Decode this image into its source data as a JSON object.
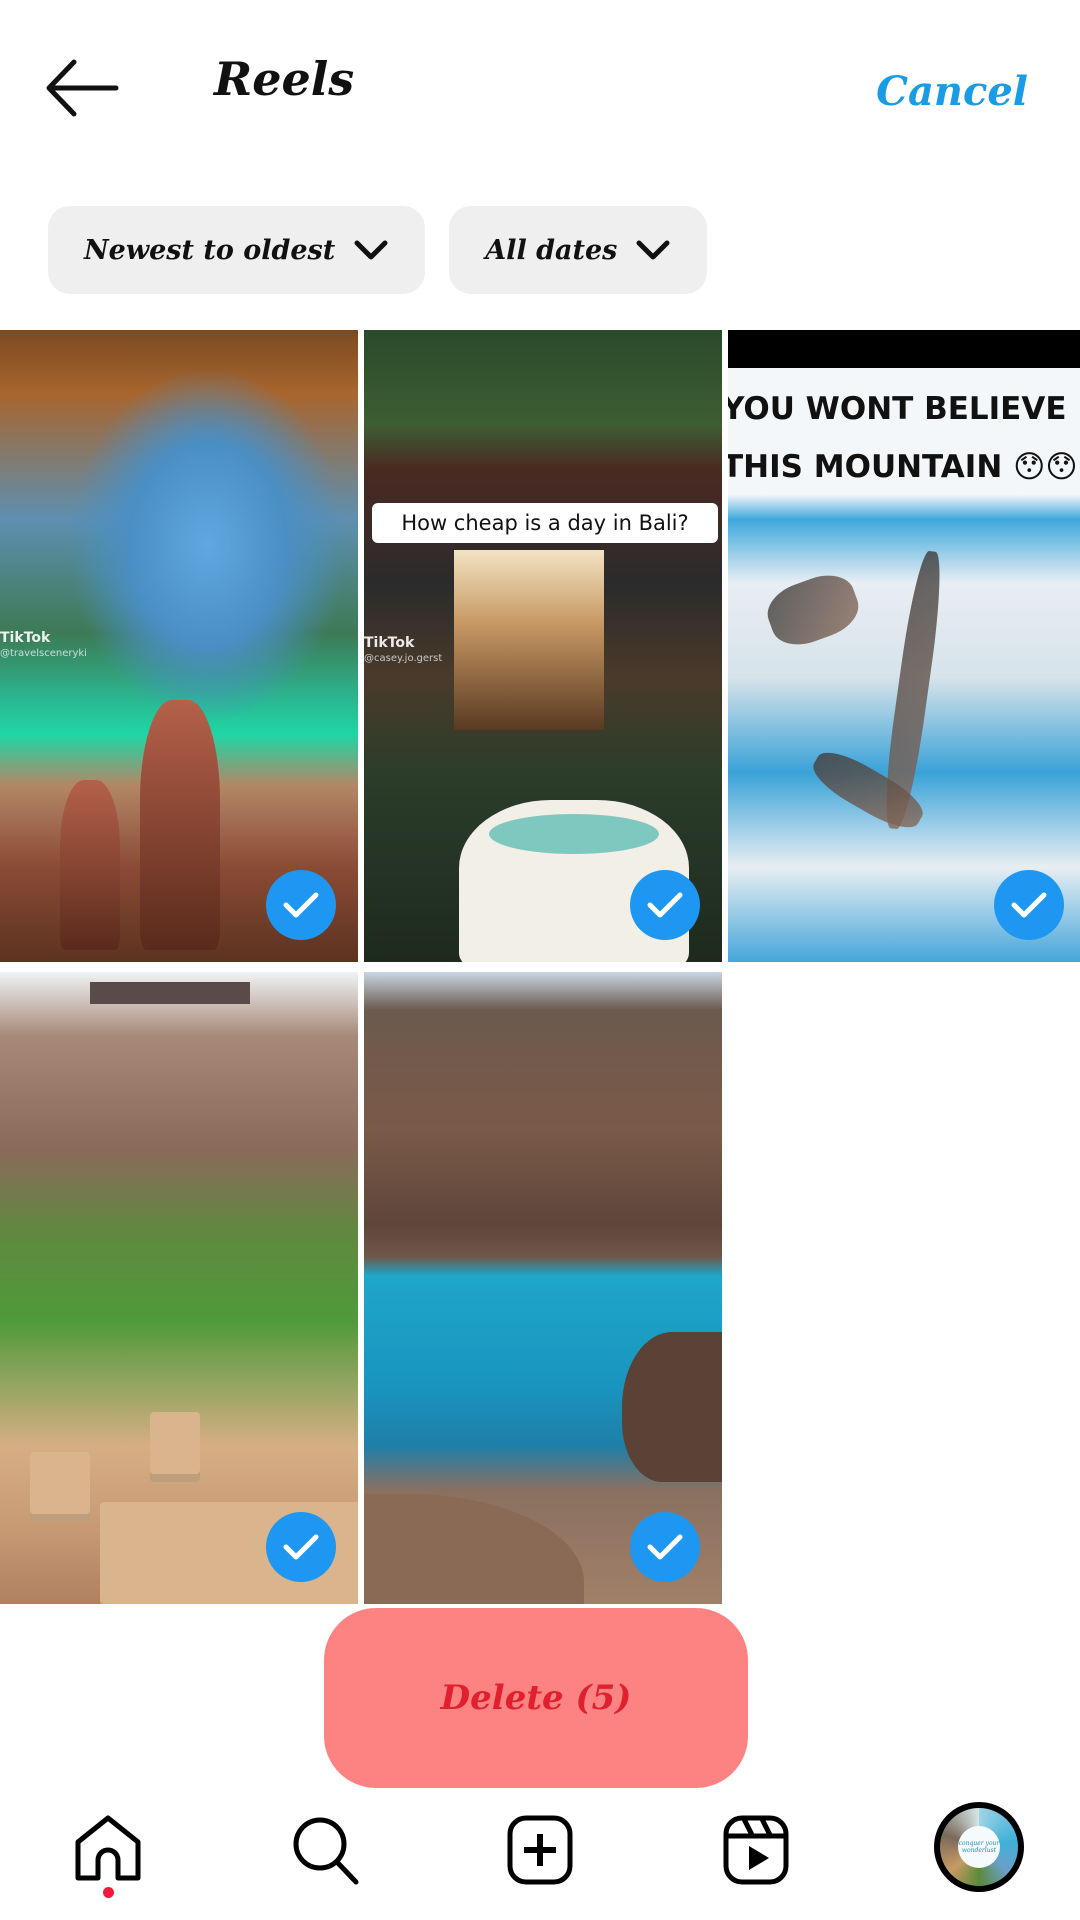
{
  "header": {
    "back_icon": "arrow-left-icon",
    "title": "Reels",
    "cancel_label": "Cancel"
  },
  "filters": [
    {
      "label": "Newest to oldest",
      "icon": "chevron-down-icon"
    },
    {
      "label": "All dates",
      "icon": "chevron-down-icon"
    }
  ],
  "reels": [
    {
      "description": "Cave overlooking turquoise lagoon",
      "watermark": "TikTok",
      "handle": "@travelsceneryki",
      "selected": true
    },
    {
      "description": "Bali villa with pool",
      "caption": "How cheap is a day in Bali?",
      "watermark": "TikTok",
      "handle": "@casey.jo.gerst",
      "selected": true
    },
    {
      "description": "Snowy mountain ridge aerial",
      "caption_line1": "YOU WONT BELIEVE",
      "caption_line2": "THIS MOUNTAIN 😯😯",
      "selected": true
    },
    {
      "description": "Roller coaster through mountain gorge",
      "selected": true
    },
    {
      "description": "Turquoise mountain lake",
      "selected": true
    }
  ],
  "selection": {
    "delete_label": "Delete (5)",
    "count": 5
  },
  "colors": {
    "accent": "#1a9be6",
    "check": "#1e97f2",
    "delete_bg": "#fd8282",
    "delete_text": "#e0202f",
    "notification_dot": "#ef1b3c"
  },
  "nav": {
    "items": [
      {
        "name": "home",
        "icon": "home-icon",
        "active": true
      },
      {
        "name": "search",
        "icon": "search-icon"
      },
      {
        "name": "create",
        "icon": "plus-square-icon"
      },
      {
        "name": "reels",
        "icon": "reels-icon"
      },
      {
        "name": "profile",
        "icon": "avatar"
      }
    ],
    "avatar_text": "conquer your wonderlust"
  }
}
